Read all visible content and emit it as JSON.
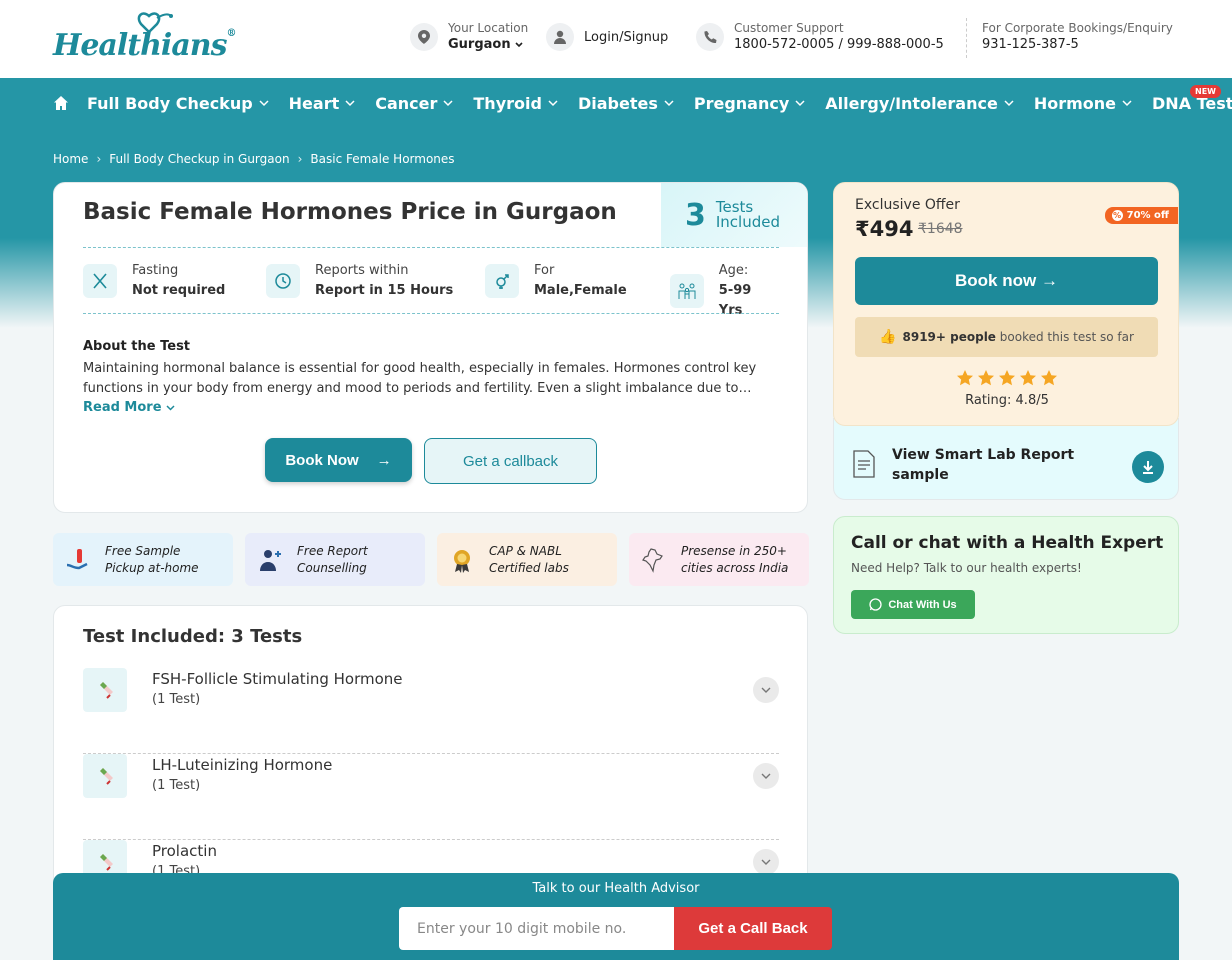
{
  "header": {
    "logo_text": "Healthians",
    "logo_reg": "®",
    "location_label": "Your Location",
    "location_value": "Gurgaon",
    "login_label": "Login/Signup",
    "support_label": "Customer Support",
    "support_numbers": "1800-572-0005 / 999-888-000-5",
    "corporate_label": "For Corporate Bookings/Enquiry",
    "corporate_number": "931-125-387-5"
  },
  "nav": {
    "items": [
      "Full Body Checkup",
      "Heart",
      "Cancer",
      "Thyroid",
      "Diabetes",
      "Pregnancy",
      "Allergy/Intolerance",
      "Hormone",
      "DNA Test"
    ],
    "new_badge": "NEW"
  },
  "breadcrumb": [
    "Home",
    "Full Body Checkup in Gurgaon",
    "Basic Female Hormones"
  ],
  "main": {
    "title": "Basic Female Hormones Price in Gurgaon",
    "tests_count": "3",
    "tests_label_1": "Tests",
    "tests_label_2": "Included",
    "facts": [
      {
        "label": "Fasting",
        "value": "Not required",
        "icon": "fork-knife-icon"
      },
      {
        "label": "Reports within",
        "value": "Report in 15 Hours",
        "icon": "clock-icon"
      },
      {
        "label": "For",
        "value": "Male,Female",
        "icon": "gender-icon"
      },
      {
        "label": "Age:",
        "value": "5-99 Yrs",
        "icon": "family-icon"
      }
    ],
    "about_heading": "About the Test",
    "about_text": "Maintaining hormonal balance is essential for good health, especially in females. Hormones control key functions in your body from energy and mood to periods and fertility. Even a slight imbalance due to…",
    "read_more": "Read More",
    "book_label": "Book Now",
    "callback_label": "Get a callback"
  },
  "features": [
    {
      "line1": "Free Sample",
      "line2": "Pickup at-home",
      "bg": "#e4f3fb"
    },
    {
      "line1": "Free Report",
      "line2": "Counselling",
      "bg": "#e8ecfa"
    },
    {
      "line1": "CAP & NABL",
      "line2": "Certified labs",
      "bg": "#fbefe2"
    },
    {
      "line1": "Presense in 250+",
      "line2": "cities across India",
      "bg": "#fbeaf1"
    }
  ],
  "tests_included": {
    "heading": "Test Included: 3 Tests",
    "items": [
      {
        "name": "FSH-Follicle Stimulating Hormone",
        "count": "(1 Test)"
      },
      {
        "name": "LH-Luteinizing Hormone",
        "count": "(1 Test)"
      },
      {
        "name": "Prolactin",
        "count": "(1 Test)"
      }
    ]
  },
  "offer": {
    "label": "Exclusive Offer",
    "price": "₹494",
    "mrp": "₹1648",
    "discount": "70% off",
    "book_label": "Book now →",
    "booked_count": "8919+ people",
    "booked_text": "booked this test so far",
    "rating": "Rating: 4.8/5",
    "stars": 5
  },
  "lab_report": {
    "text": "View Smart Lab Report sample"
  },
  "expert": {
    "heading": "Call or chat with a Health Expert",
    "subtext": "Need Help? Talk to our health experts!",
    "chat_label": "Chat With Us"
  },
  "advisor": {
    "heading": "Talk to our Health Advisor",
    "placeholder": "Enter your 10 digit mobile no.",
    "button": "Get a Call Back"
  },
  "colors": {
    "primary": "#1d8a9a",
    "nav": "#2596a6",
    "accent": "#dd3a3a",
    "offer_bg": "#fdf1de"
  }
}
